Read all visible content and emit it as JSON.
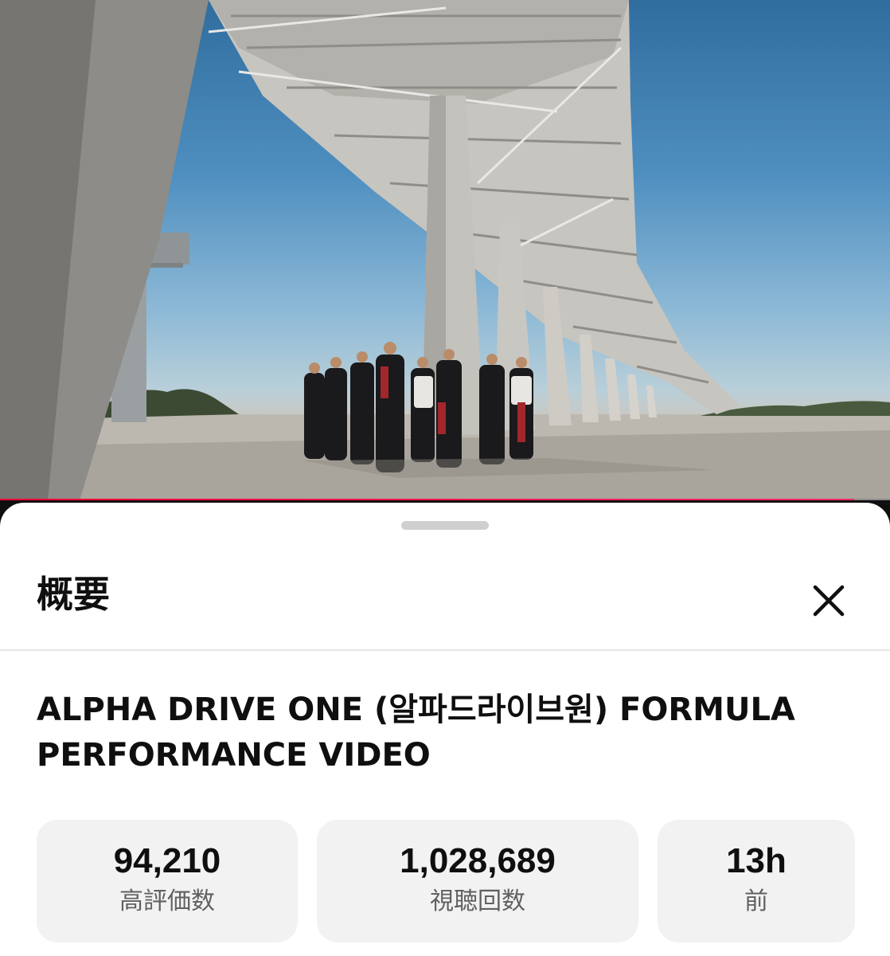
{
  "player": {
    "progress_fraction": 0.96,
    "accent_color": "#ff0033"
  },
  "sheet": {
    "title": "概要",
    "close_icon": "close-icon",
    "video_title": "ALPHA DRIVE ONE (알파드라이브원)  FORMULA PERFORMANCE VIDEO",
    "stats": [
      {
        "value": "94,210",
        "label": "高評価数"
      },
      {
        "value": "1,028,689",
        "label": "視聴回数"
      },
      {
        "value": "13h",
        "label": "前"
      }
    ]
  }
}
